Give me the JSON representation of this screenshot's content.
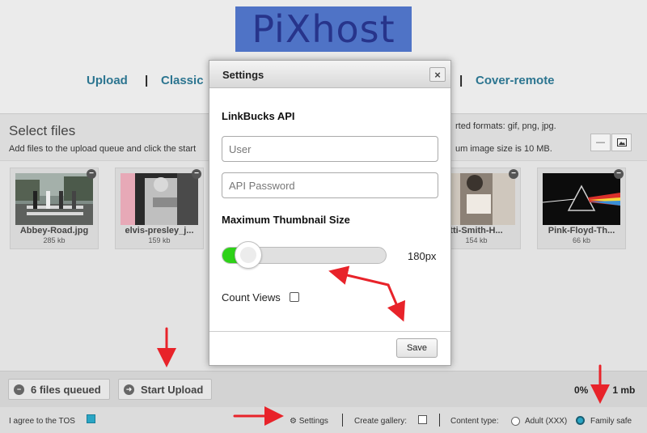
{
  "logo": {
    "text": "PiXhost"
  },
  "nav": {
    "upload": "Upload",
    "classic": "Classic",
    "cover_remote": "Cover-remote",
    "separator": "|"
  },
  "uploader": {
    "title": "Select files",
    "description": "Add files to the upload queue and click the start",
    "formats": "rted formats: gif, png, jpg.",
    "max_size": "um image size is 10 MB.",
    "view_icons": [
      "list-view-icon",
      "thumbnail-view-icon"
    ]
  },
  "thumbnails": [
    {
      "name": "Abbey-Road.jpg",
      "size": "285 kb"
    },
    {
      "name": "elvis-presley_j...",
      "size": "159 kb"
    },
    {
      "name": "tti-Smith-H...",
      "size": "154 kb"
    },
    {
      "name": "Pink-Floyd-Th...",
      "size": "66 kb"
    }
  ],
  "footer": {
    "files_queued": "6 files queued",
    "start_upload": "Start Upload",
    "progress_percent": "0%",
    "progress_size": "1 mb",
    "tos_label": "I agree to the TOS",
    "tos_checked": true,
    "settings_label": "Settings",
    "create_gallery_label": "Create gallery:",
    "content_type_label": "Content type:",
    "adult_label": "Adult (XXX)",
    "family_safe_label": "Family safe",
    "selected_content_type": "Family safe"
  },
  "modal": {
    "title": "Settings",
    "close": "×",
    "linkbucks_heading": "LinkBucks API",
    "user_placeholder": "User",
    "password_placeholder": "API Password",
    "thumb_heading": "Maximum Thumbnail Size",
    "thumb_value": "180px",
    "thumb_fill_fraction": 0.12,
    "count_views_label": "Count Views",
    "count_views_checked": false,
    "save_label": "Save"
  },
  "colors": {
    "accent": "#2c7590",
    "slider_fill": "#2dd217",
    "annotation_arrow": "#e8232a",
    "logo_bg": "#4f73c6"
  }
}
